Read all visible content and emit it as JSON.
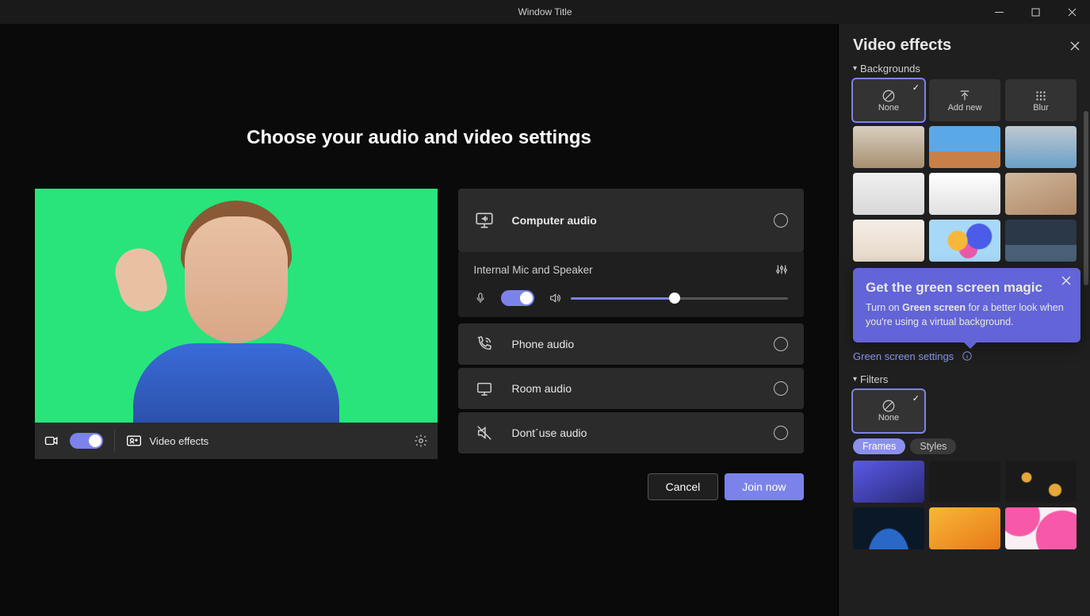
{
  "window": {
    "title": "Window Title"
  },
  "heading": "Choose your audio and video settings",
  "video_toolbar": {
    "effects_label": "Video effects"
  },
  "audio": {
    "computer": "Computer audio",
    "device": "Internal Mic and Speaker",
    "phone": "Phone audio",
    "room": "Room audio",
    "none": "Dont´use audio"
  },
  "footer": {
    "cancel": "Cancel",
    "join": "Join now"
  },
  "panel": {
    "title": "Video effects",
    "sections": {
      "backgrounds": "Backgrounds",
      "filters": "Filters"
    },
    "bg_tiles": {
      "none": "None",
      "add": "Add new",
      "blur": "Blur"
    },
    "filter_tiles": {
      "none": "None"
    },
    "tooltip": {
      "title": "Get the green screen magic",
      "body_pre": "Turn on ",
      "body_bold": "Green screen",
      "body_post": " for a better look when you're using a virtual background."
    },
    "green_screen_link": "Green screen settings",
    "pills": {
      "frames": "Frames",
      "styles": "Styles"
    }
  }
}
